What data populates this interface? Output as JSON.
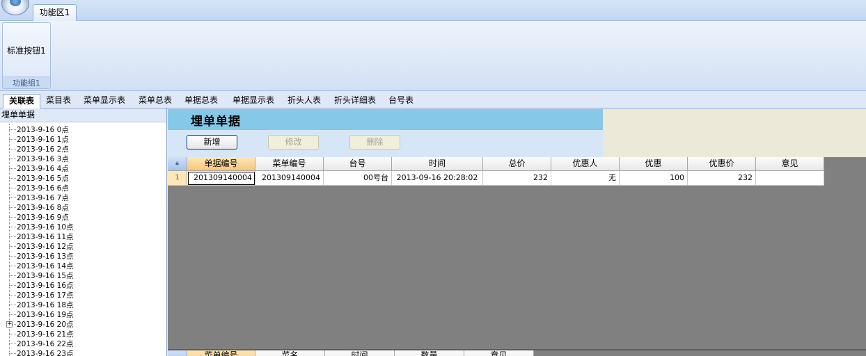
{
  "ribbon": {
    "tab_label": "功能区1",
    "button_label": "标准按钮1",
    "group_label": "功能组1"
  },
  "report_tabs": [
    {
      "label": "关联表",
      "active": true
    },
    {
      "label": "菜目表"
    },
    {
      "label": "菜单显示表"
    },
    {
      "label": "菜单总表"
    },
    {
      "label": "单据总表"
    },
    {
      "label": "单据显示表"
    },
    {
      "label": "折头人表"
    },
    {
      "label": "折头详细表"
    },
    {
      "label": "台号表"
    }
  ],
  "tree": {
    "title": "埋单单据",
    "items": [
      "2013-9-16  0点",
      "2013-9-16  1点",
      "2013-9-16  2点",
      "2013-9-16  3点",
      "2013-9-16  4点",
      "2013-9-16  5点",
      "2013-9-16  6点",
      "2013-9-16  7点",
      "2013-9-16  8点",
      "2013-9-16  9点",
      "2013-9-16  10点",
      "2013-9-16  11点",
      "2013-9-16  12点",
      "2013-9-16  13点",
      "2013-9-16  14点",
      "2013-9-16  15点",
      "2013-9-16  16点",
      "2013-9-16  17点",
      "2013-9-16  18点",
      "2013-9-16  19点",
      "2013-9-16  20点",
      "2013-9-16  21点",
      "2013-9-16  22点",
      "2013-9-16  23点"
    ],
    "expander_symbol": "+"
  },
  "form": {
    "title": "埋单单据",
    "buttons": {
      "add": "新增",
      "edit": "修改",
      "delete": "删除"
    }
  },
  "grid": {
    "corner_icon": "lock-icon",
    "columns": [
      "单据编号",
      "菜单编号",
      "台号",
      "时间",
      "总价",
      "优惠人",
      "优惠",
      "优惠价",
      "意见"
    ],
    "rows": [
      {
        "row_number": "1",
        "cells": [
          "201309140004",
          "201309140004",
          "00号台",
          "2013-09-16 20:28:02",
          "232",
          "无",
          "100",
          "232",
          ""
        ]
      }
    ]
  },
  "grid2": {
    "columns": [
      "菜单编号",
      "菜名",
      "时间",
      "数量",
      "意见"
    ]
  },
  "colors": {
    "form_header": "#86c8e8",
    "grid_background": "#808080",
    "sorted_header": "#f8c679"
  }
}
